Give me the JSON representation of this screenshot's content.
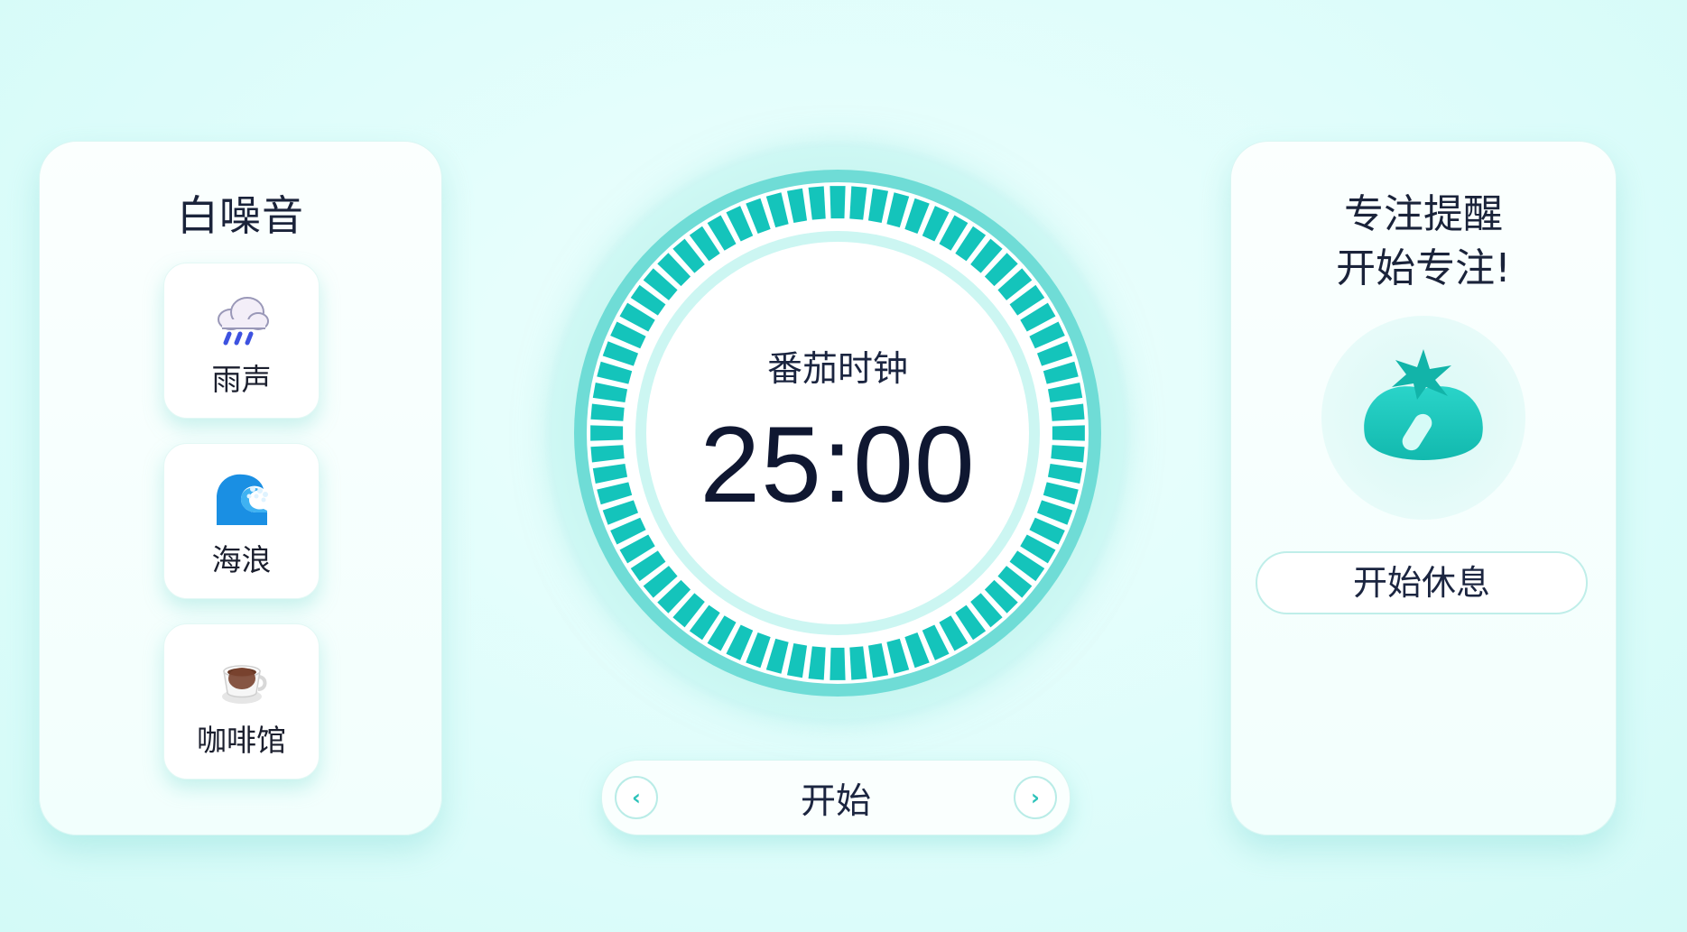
{
  "white_noise": {
    "title": "白噪音",
    "items": [
      {
        "label": "雨声",
        "icon": "rain-cloud-icon"
      },
      {
        "label": "海浪",
        "icon": "ocean-wave-icon"
      },
      {
        "label": "咖啡馆",
        "icon": "coffee-cup-icon"
      }
    ]
  },
  "timer": {
    "title": "番茄时钟",
    "value": "25:00",
    "tick_count": 72
  },
  "controls": {
    "prev_label": "‹",
    "start_label": "开始",
    "next_label": "›"
  },
  "focus": {
    "line1": "专注提醒",
    "line2": "开始专注!",
    "break_label": "开始休息",
    "icon": "tomato-icon"
  },
  "colors": {
    "accent": "#14c4bb",
    "accent_light": "#6ddcd6",
    "background": "#dffdfb"
  }
}
